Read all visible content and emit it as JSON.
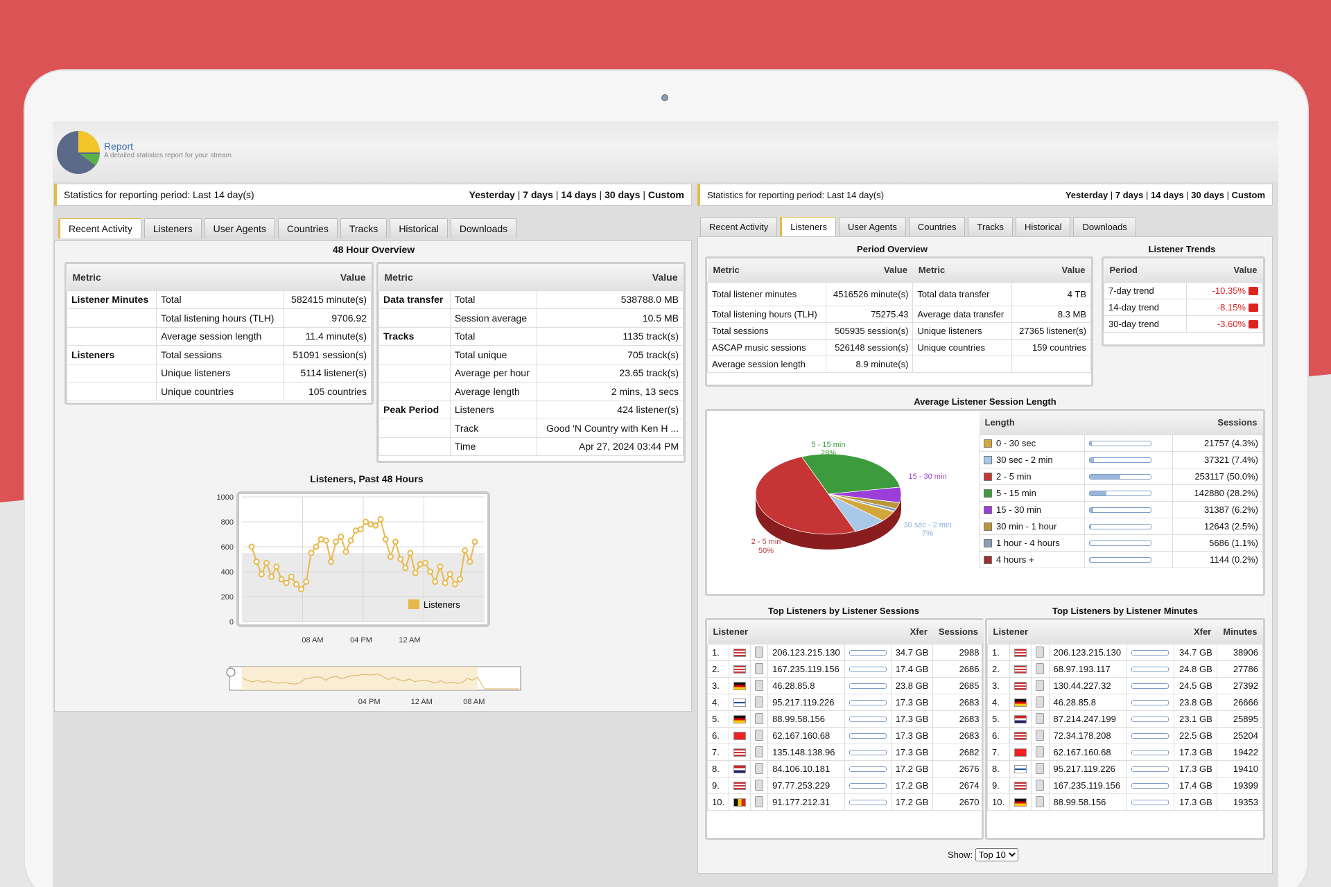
{
  "brand": {
    "title": "Report",
    "subtitle": "A detailed statistics report for your stream"
  },
  "left": {
    "period_label": "Statistics for reporting period: Last 14 day(s)",
    "period_links": [
      "Yesterday",
      "7 days",
      "14 days",
      "30 days",
      "Custom"
    ],
    "tabs": [
      "Recent Activity",
      "Listeners",
      "User Agents",
      "Countries",
      "Tracks",
      "Historical",
      "Downloads"
    ],
    "active_tab": "Recent Activity",
    "overview_title": "48 Hour Overview",
    "t1": {
      "h_metric": "Metric",
      "h_value": "Value",
      "rows": [
        {
          "g": "Listener Minutes",
          "m": "Total",
          "v": "582415 minute(s)"
        },
        {
          "g": "",
          "m": "Total listening hours (TLH)",
          "v": "9706.92"
        },
        {
          "g": "",
          "m": "Average session length",
          "v": "11.4 minute(s)"
        },
        {
          "g": "Listeners",
          "m": "Total sessions",
          "v": "51091 session(s)"
        },
        {
          "g": "",
          "m": "Unique listeners",
          "v": "5114 listener(s)"
        },
        {
          "g": "",
          "m": "Unique countries",
          "v": "105 countries"
        }
      ]
    },
    "t2": {
      "h_metric": "Metric",
      "h_value": "Value",
      "rows": [
        {
          "g": "Data transfer",
          "m": "Total",
          "v": "538788.0 MB"
        },
        {
          "g": "",
          "m": "Session average",
          "v": "10.5 MB"
        },
        {
          "g": "Tracks",
          "m": "Total",
          "v": "1135 track(s)"
        },
        {
          "g": "",
          "m": "Total unique",
          "v": "705 track(s)"
        },
        {
          "g": "",
          "m": "Average per hour",
          "v": "23.65 track(s)"
        },
        {
          "g": "",
          "m": "Average length",
          "v": "2 mins, 13 secs"
        },
        {
          "g": "Peak Period",
          "m": "Listeners",
          "v": "424 listener(s)"
        },
        {
          "g": "",
          "m": "Track",
          "v": "Good 'N Country with Ken H ..."
        },
        {
          "g": "",
          "m": "Time",
          "v": "Apr 27, 2024 03:44 PM"
        }
      ]
    },
    "chart_title": "Listeners, Past 48 Hours",
    "nav_ticks": [
      "04 PM",
      "12 AM",
      "08 AM"
    ]
  },
  "chart_data": {
    "type": "line",
    "title": "Listeners, Past 48 Hours",
    "ylim": [
      0,
      1000
    ],
    "yticks": [
      "1000",
      "800",
      "600",
      "400",
      "200",
      "0"
    ],
    "xticks": [
      "08 AM",
      "04 PM",
      "12 AM"
    ],
    "series": [
      {
        "name": "Listeners",
        "color": "#e8b84a",
        "values": [
          600,
          480,
          380,
          470,
          360,
          440,
          340,
          310,
          360,
          300,
          260,
          320,
          550,
          600,
          660,
          650,
          480,
          640,
          680,
          560,
          650,
          730,
          740,
          800,
          780,
          770,
          820,
          660,
          520,
          640,
          500,
          430,
          550,
          390,
          460,
          470,
          400,
          320,
          440,
          310,
          380,
          300,
          340,
          570,
          480,
          640
        ]
      }
    ],
    "grid": true,
    "legend": "bottom-right"
  },
  "right": {
    "period_label": "Statistics for reporting period: Last 14 day(s)",
    "period_links": [
      "Yesterday",
      "7 days",
      "14 days",
      "30 days",
      "Custom"
    ],
    "tabs": [
      "Recent Activity",
      "Listeners",
      "User Agents",
      "Countries",
      "Tracks",
      "Historical",
      "Downloads"
    ],
    "active_tab": "Listeners",
    "po_title": "Period Overview",
    "po": {
      "h_metric": "Metric",
      "h_value": "Value",
      "rows": [
        {
          "m1": "Total listener minutes",
          "v1": "4516526 minute(s)",
          "m2": "Total data transfer",
          "v2": "4 TB"
        },
        {
          "m1": "Total listening hours (TLH)",
          "v1": "75275.43",
          "m2": "Average data transfer",
          "v2": "8.3 MB"
        },
        {
          "m1": "Total sessions",
          "v1": "505935 session(s)",
          "m2": "Unique listeners",
          "v2": "27365 listener(s)"
        },
        {
          "m1": "ASCAP music sessions",
          "v1": "526148 session(s)",
          "m2": "Unique countries",
          "v2": "159 countries"
        },
        {
          "m1": "Average session length",
          "v1": "8.9 minute(s)",
          "m2": "",
          "v2": ""
        }
      ]
    },
    "lt_title": "Listener Trends",
    "lt": {
      "h_period": "Period",
      "h_value": "Value",
      "rows": [
        {
          "p": "7-day trend",
          "v": "-10.35%"
        },
        {
          "p": "14-day trend",
          "v": "-8.15%"
        },
        {
          "p": "30-day trend",
          "v": "-3.60%"
        }
      ]
    },
    "asl_title": "Average Listener Session Length",
    "asl": {
      "h_length": "Length",
      "h_sessions": "Sessions",
      "rows": [
        {
          "l": "0 - 30 sec",
          "s": "21757 (4.3%)",
          "pct": 4.3,
          "c": "#d4a73a"
        },
        {
          "l": "30 sec - 2 min",
          "s": "37321 (7.4%)",
          "pct": 7.4,
          "c": "#a8c8e8"
        },
        {
          "l": "2 - 5 min",
          "s": "253117 (50.0%)",
          "pct": 50.0,
          "c": "#c53535"
        },
        {
          "l": "5 - 15 min",
          "s": "142880 (28.2%)",
          "pct": 28.2,
          "c": "#3c9b3c"
        },
        {
          "l": "15 - 30 min",
          "s": "31387 (6.2%)",
          "pct": 6.2,
          "c": "#9b3fd8"
        },
        {
          "l": "30 min - 1 hour",
          "s": "12643 (2.5%)",
          "pct": 2.5,
          "c": "#b8973a"
        },
        {
          "l": "1 hour - 4 hours",
          "s": "5686 (1.1%)",
          "pct": 1.1,
          "c": "#8aa0b8"
        },
        {
          "l": "4 hours +",
          "s": "1144 (0.2%)",
          "pct": 0.2,
          "c": "#a03030"
        }
      ]
    },
    "pie_labels": {
      "a": "5 - 15 min",
      "ap": "28%",
      "b": "2 - 5 min",
      "bp": "50%",
      "c": "15 - 30 min",
      "d": "30 sec - 2 min",
      "dp": "7%"
    },
    "ts_title": "Top Listeners by Listener Sessions",
    "ts": {
      "h_l": "Listener",
      "h_x": "Xfer",
      "h_s": "Sessions",
      "rows": [
        {
          "n": "1.",
          "ip": "206.123.215.130",
          "x": "34.7 GB",
          "s": "2988",
          "f": "us",
          "b": 55
        },
        {
          "n": "2.",
          "ip": "167.235.119.156",
          "x": "17.4 GB",
          "s": "2686",
          "f": "us",
          "b": 28
        },
        {
          "n": "3.",
          "ip": "46.28.85.8",
          "x": "23.8 GB",
          "s": "2685",
          "f": "de",
          "b": 38
        },
        {
          "n": "4.",
          "ip": "95.217.119.226",
          "x": "17.3 GB",
          "s": "2683",
          "f": "fi",
          "b": 28
        },
        {
          "n": "5.",
          "ip": "88.99.58.156",
          "x": "17.3 GB",
          "s": "2683",
          "f": "de",
          "b": 28
        },
        {
          "n": "6.",
          "ip": "62.167.160.68",
          "x": "17.3 GB",
          "s": "2683",
          "f": "ch",
          "b": 28
        },
        {
          "n": "7.",
          "ip": "135.148.138.96",
          "x": "17.3 GB",
          "s": "2682",
          "f": "us",
          "b": 28
        },
        {
          "n": "8.",
          "ip": "84.106.10.181",
          "x": "17.2 GB",
          "s": "2676",
          "f": "nl",
          "b": 28
        },
        {
          "n": "9.",
          "ip": "97.77.253.229",
          "x": "17.2 GB",
          "s": "2674",
          "f": "us",
          "b": 28
        },
        {
          "n": "10.",
          "ip": "91.177.212.31",
          "x": "17.2 GB",
          "s": "2670",
          "f": "be",
          "b": 28
        }
      ]
    },
    "tm_title": "Top Listeners by Listener Minutes",
    "tm": {
      "h_l": "Listener",
      "h_x": "Xfer",
      "h_s": "Minutes",
      "rows": [
        {
          "n": "1.",
          "ip": "206.123.215.130",
          "x": "34.7 GB",
          "s": "38906",
          "f": "us",
          "b": 55
        },
        {
          "n": "2.",
          "ip": "68.97.193.117",
          "x": "24.8 GB",
          "s": "27786",
          "f": "us",
          "b": 40
        },
        {
          "n": "3.",
          "ip": "130.44.227.32",
          "x": "24.5 GB",
          "s": "27392",
          "f": "us",
          "b": 40
        },
        {
          "n": "4.",
          "ip": "46.28.85.8",
          "x": "23.8 GB",
          "s": "26666",
          "f": "de",
          "b": 38
        },
        {
          "n": "5.",
          "ip": "87.214.247.199",
          "x": "23.1 GB",
          "s": "25895",
          "f": "nl",
          "b": 37
        },
        {
          "n": "6.",
          "ip": "72.34.178.208",
          "x": "22.5 GB",
          "s": "25204",
          "f": "us",
          "b": 36
        },
        {
          "n": "7.",
          "ip": "62.167.160.68",
          "x": "17.3 GB",
          "s": "19422",
          "f": "ch",
          "b": 28
        },
        {
          "n": "8.",
          "ip": "95.217.119.226",
          "x": "17.3 GB",
          "s": "19410",
          "f": "fi",
          "b": 28
        },
        {
          "n": "9.",
          "ip": "167.235.119.156",
          "x": "17.4 GB",
          "s": "19399",
          "f": "us",
          "b": 28
        },
        {
          "n": "10.",
          "ip": "88.99.58.156",
          "x": "17.3 GB",
          "s": "19353",
          "f": "de",
          "b": 28
        }
      ]
    },
    "show_label": "Show:",
    "show_value": "Top 10"
  }
}
